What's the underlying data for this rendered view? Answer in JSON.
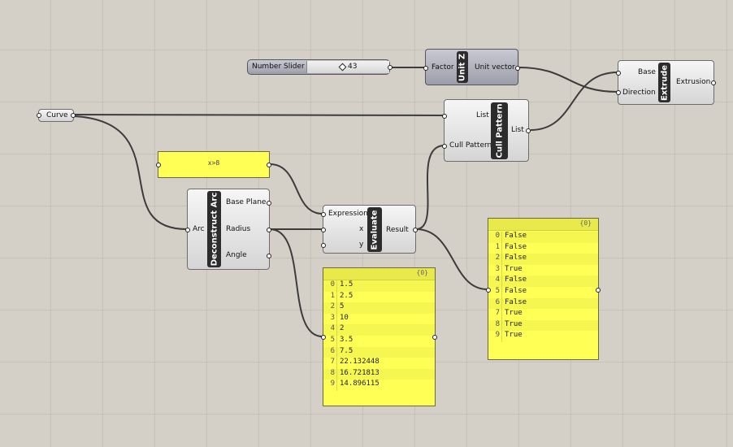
{
  "slider": {
    "label": "Number Slider",
    "value": "43"
  },
  "curve": {
    "label": "Curve"
  },
  "unit_z": {
    "title": "Unit Z",
    "input": "Factor",
    "output": "Unit vector"
  },
  "extrude": {
    "title": "Extrude",
    "inputs": [
      "Base",
      "Direction"
    ],
    "output": "Extrusion"
  },
  "cull_pattern": {
    "title": "Cull Pattern",
    "inputs": [
      "List",
      "Cull Pattern"
    ],
    "output": "List"
  },
  "expression_panel": {
    "text": "x>8"
  },
  "deconstruct_arc": {
    "title": "Deconstruct Arc",
    "input": "Arc",
    "outputs": [
      "Base Plane",
      "Radius",
      "Angle"
    ]
  },
  "evaluate": {
    "title": "Evaluate",
    "inputs": [
      "Expression",
      "x",
      "y"
    ],
    "output": "Result"
  },
  "radius_panel": {
    "path": "{0}",
    "items": [
      "1.5",
      "2.5",
      "5",
      "10",
      "2",
      "3.5",
      "7.5",
      "22.132448",
      "16.721813",
      "14.896115"
    ]
  },
  "result_panel": {
    "path": "{0}",
    "items": [
      "False",
      "False",
      "False",
      "True",
      "False",
      "False",
      "False",
      "True",
      "True",
      "True"
    ]
  }
}
